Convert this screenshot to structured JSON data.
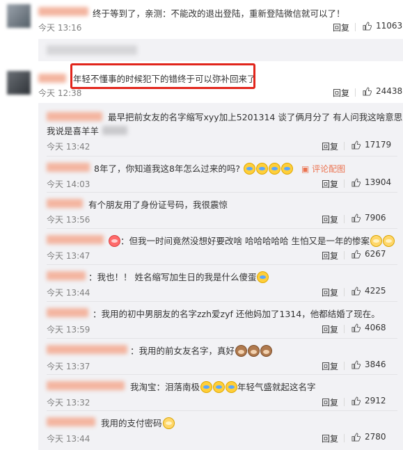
{
  "comments": [
    {
      "text": "终于等到了，亲测：不能改的退出登陆，重新登陆微信就可以了！",
      "time": "今天 13:16",
      "reply": "回复",
      "likes": "11063"
    },
    {
      "text": "年轻不懂事的时候犯下的错终于可以弥补回来了",
      "time": "今天 12:38",
      "reply": "回复",
      "likes": "24438"
    }
  ],
  "replies": [
    {
      "text": "最早把前女友的名字缩写xyy加上5201314 谈了俩月分了 有人问我这啥意思",
      "text2": "我说是喜羊羊",
      "time": "今天 13:42",
      "reply": "回复",
      "likes": "17179"
    },
    {
      "text": "8年了，你知道我这8年怎么过来的吗?",
      "time": "今天 14:03",
      "reply": "回复",
      "likes": "13904",
      "pic_link": "评论配图"
    },
    {
      "text": "有个朋友用了身份证号码，我很震惊",
      "time": "今天 13:56",
      "reply": "回复",
      "likes": "7906"
    },
    {
      "text": "：但我一时间竟然没想好要改啥 哈哈哈哈哈 生怕又是一年的惨案",
      "time": "今天 13:47",
      "reply": "回复",
      "likes": "6267"
    },
    {
      "text": "：我也！！ 姓名缩写加生日的我是什么傻蛋",
      "time": "今天 13:44",
      "reply": "回复",
      "likes": "4225"
    },
    {
      "text": "：我用的初中男朋友的名字zzh爱zyf 还他妈加了1314，他都结婚了现在。",
      "time": "今天 13:59",
      "reply": "回复",
      "likes": "4068"
    },
    {
      "text": "：我用的前女友名字，真好",
      "time": "今天 13:37",
      "reply": "回复",
      "likes": "3846"
    },
    {
      "text": "我淘宝：泪落南极",
      "text2": "年轻气盛就起这名字",
      "time": "今天 13:32",
      "reply": "回复",
      "likes": "2912"
    },
    {
      "text": "我用的支付密码",
      "time": "今天 13:44",
      "reply": "回复",
      "likes": "2780"
    }
  ],
  "colors": {
    "accent": "#eb7350",
    "highlight": "#e1251b",
    "subbg": "#f2f2f5"
  },
  "icons": {
    "like": "thumbs-up-icon"
  }
}
